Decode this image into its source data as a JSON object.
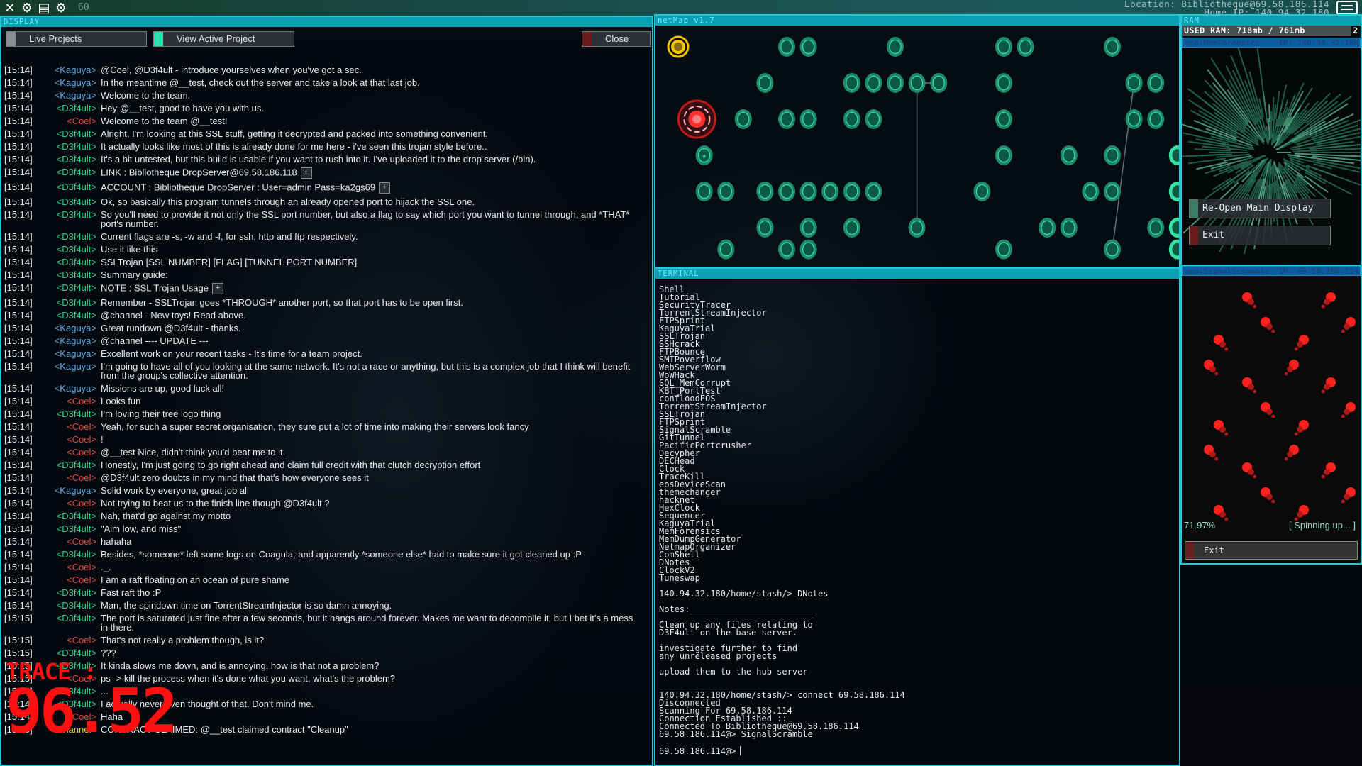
{
  "topbar": {
    "icons": [
      "close-icon",
      "gear-icon",
      "save-icon",
      "gear-icon"
    ],
    "fps": "60",
    "location": "Location: Bibliotheque@69.58.186.114",
    "home_ip": "Home IP: 140.94.32.180"
  },
  "display": {
    "title": "DISPLAY",
    "live_projects": "Live Projects",
    "view_active_project": "View Active Project",
    "close": "Close",
    "messages": [
      {
        "ts": "[15:14]",
        "nick": "<Kaguya>",
        "cls": "kaguya",
        "text": "@Coel, @D3f4ult - introduce yourselves when you've got a sec."
      },
      {
        "ts": "[15:14]",
        "nick": "<Kaguya>",
        "cls": "kaguya",
        "text": "In the meantime @__test, check out the server and take a look at that last job."
      },
      {
        "ts": "[15:14]",
        "nick": "<Kaguya>",
        "cls": "kaguya",
        "text": "Welcome to the team."
      },
      {
        "ts": "[15:14]",
        "nick": "<D3f4ult>",
        "cls": "d3f4ult",
        "text": "Hey @__test, good to have you with us."
      },
      {
        "ts": "[15:14]",
        "nick": "<Coel>",
        "cls": "coel",
        "text": "Welcome to the team @__test!"
      },
      {
        "ts": "[15:14]",
        "nick": "<D3f4ult>",
        "cls": "d3f4ult",
        "text": "Alright, I'm looking at this SSL stuff, getting it decrypted and packed into something convenient."
      },
      {
        "ts": "[15:14]",
        "nick": "<D3f4ult>",
        "cls": "d3f4ult",
        "text": "It actually looks like most of this is already done for me here - i've seen this trojan style before.."
      },
      {
        "ts": "[15:14]",
        "nick": "<D3f4ult>",
        "cls": "d3f4ult",
        "text": "It's a bit untested, but this build is usable if you want to rush into it. I've uploaded it to the drop server (/bin)."
      },
      {
        "ts": "[15:14]",
        "nick": "<D3f4ult>",
        "cls": "d3f4ult",
        "text": "LINK : Bibliotheque DropServer@69.58.186.118",
        "plus": true
      },
      {
        "ts": "[15:14]",
        "nick": "<D3f4ult>",
        "cls": "d3f4ult",
        "text": "ACCOUNT : Bibliotheque DropServer : User=admin Pass=ka2gs69",
        "plus": true
      },
      {
        "ts": "[15:14]",
        "nick": "<D3f4ult>",
        "cls": "d3f4ult",
        "text": "Ok, so basically this program tunnels through an already opened port to hijack the SSL one."
      },
      {
        "ts": "[15:14]",
        "nick": "<D3f4ult>",
        "cls": "d3f4ult",
        "text": "So you'll need to provide it not only the SSL port number, but also a flag to say which port you want to tunnel through, and *THAT* port's number."
      },
      {
        "ts": "[15:14]",
        "nick": "<D3f4ult>",
        "cls": "d3f4ult",
        "text": "Current flags are -s, -w and -f, for ssh, http and ftp respectively."
      },
      {
        "ts": "[15:14]",
        "nick": "<D3f4ult>",
        "cls": "d3f4ult",
        "text": "Use it like this"
      },
      {
        "ts": "[15:14]",
        "nick": "<D3f4ult>",
        "cls": "d3f4ult",
        "text": "SSLTrojan [SSL NUMBER] [FLAG] [TUNNEL PORT NUMBER]"
      },
      {
        "ts": "[15:14]",
        "nick": "<D3f4ult>",
        "cls": "d3f4ult",
        "text": "Summary guide:"
      },
      {
        "ts": "[15:14]",
        "nick": "<D3f4ult>",
        "cls": "d3f4ult",
        "text": "NOTE : SSL Trojan Usage",
        "plus": true
      },
      {
        "ts": "[15:14]",
        "nick": "<D3f4ult>",
        "cls": "d3f4ult",
        "text": "Remember - SSLTrojan goes *THROUGH* another port, so that port has to be open first."
      },
      {
        "ts": "[15:14]",
        "nick": "<D3f4ult>",
        "cls": "d3f4ult",
        "text": "@channel - New toys! Read above."
      },
      {
        "ts": "[15:14]",
        "nick": "<Kaguya>",
        "cls": "kaguya",
        "text": "Great rundown @D3f4ult - thanks."
      },
      {
        "ts": "[15:14]",
        "nick": "<Kaguya>",
        "cls": "kaguya",
        "text": "@channel ---- UPDATE ---"
      },
      {
        "ts": "[15:14]",
        "nick": "<Kaguya>",
        "cls": "kaguya",
        "text": "Excellent work on your recent tasks - It's time for a team project."
      },
      {
        "ts": "[15:14]",
        "nick": "<Kaguya>",
        "cls": "kaguya",
        "text": "I'm going to have all of you looking at the same network. It's not a race or anything, but this is a complex job that I think will benefit from the group's collective attention."
      },
      {
        "ts": "[15:14]",
        "nick": "<Kaguya>",
        "cls": "kaguya",
        "text": "Missions are up, good luck all!"
      },
      {
        "ts": "[15:14]",
        "nick": "<Coel>",
        "cls": "coel",
        "text": "Looks fun"
      },
      {
        "ts": "[15:14]",
        "nick": "<D3f4ult>",
        "cls": "d3f4ult",
        "text": "I'm loving their tree logo thing"
      },
      {
        "ts": "[15:14]",
        "nick": "<Coel>",
        "cls": "coel",
        "text": "Yeah, for such a super secret organisation, they sure put a lot of time into making their servers look fancy"
      },
      {
        "ts": "[15:14]",
        "nick": "<Coel>",
        "cls": "coel",
        "text": "!"
      },
      {
        "ts": "[15:14]",
        "nick": "<Coel>",
        "cls": "coel",
        "text": "@__test Nice, didn't think you'd beat me to it."
      },
      {
        "ts": "[15:14]",
        "nick": "<D3f4ult>",
        "cls": "d3f4ult",
        "text": "Honestly, I'm just going to go right ahead and claim full credit with that clutch decryption effort"
      },
      {
        "ts": "[15:14]",
        "nick": "<Coel>",
        "cls": "coel",
        "text": "@D3f4ult zero doubts in my mind that that's how everyone sees it"
      },
      {
        "ts": "[15:14]",
        "nick": "<Kaguya>",
        "cls": "kaguya",
        "text": "Solid work by everyone, great job all"
      },
      {
        "ts": "[15:14]",
        "nick": "<Coel>",
        "cls": "coel",
        "text": "Not trying to beat us to the finish line though @D3f4ult ?"
      },
      {
        "ts": "[15:14]",
        "nick": "<D3f4ult>",
        "cls": "d3f4ult",
        "text": "Nah, that'd go against my motto"
      },
      {
        "ts": "[15:14]",
        "nick": "<D3f4ult>",
        "cls": "d3f4ult",
        "text": "\"Aim low, and miss\""
      },
      {
        "ts": "[15:14]",
        "nick": "<Coel>",
        "cls": "coel",
        "text": "hahaha"
      },
      {
        "ts": "[15:14]",
        "nick": "<D3f4ult>",
        "cls": "d3f4ult",
        "text": "Besides, *someone* left some logs on Coagula, and apparently *someone else* had to make sure it got cleaned up :P"
      },
      {
        "ts": "[15:14]",
        "nick": "<Coel>",
        "cls": "coel",
        "text": "._."
      },
      {
        "ts": "[15:14]",
        "nick": "<Coel>",
        "cls": "coel",
        "text": "I am a raft floating on an ocean of pure shame"
      },
      {
        "ts": "[15:14]",
        "nick": "<D3f4ult>",
        "cls": "d3f4ult",
        "text": "Fast raft tho :P"
      },
      {
        "ts": "[15:14]",
        "nick": "<D3f4ult>",
        "cls": "d3f4ult",
        "text": "Man, the spindown time on TorrentStreamInjector is so damn annoying."
      },
      {
        "ts": "[15:15]",
        "nick": "<D3f4ult>",
        "cls": "d3f4ult",
        "text": "The port is saturated just fine after a few seconds, but it hangs around forever. Makes me want to decompile it, but I bet it's a mess in there."
      },
      {
        "ts": "[15:15]",
        "nick": "<Coel>",
        "cls": "coel",
        "text": "That's not really a problem though, is it?"
      },
      {
        "ts": "[15:15]",
        "nick": "<D3f4ult>",
        "cls": "d3f4ult",
        "text": "???"
      },
      {
        "ts": "[15:15]",
        "nick": "<D3f4ult>",
        "cls": "d3f4ult",
        "text": "It kinda slows me down, and is annoying, how is that not a problem?"
      },
      {
        "ts": "[15:15]",
        "nick": "<Coel>",
        "cls": "coel",
        "text": "ps -> kill the process when it's done what you want, what's the problem?"
      },
      {
        "ts": "[15:15]",
        "nick": "<D3f4ult>",
        "cls": "d3f4ult",
        "text": "..."
      },
      {
        "ts": "[15:14]",
        "nick": "<D3f4ult>",
        "cls": "d3f4ult",
        "text": "I actually never even thought of that. Don't mind me."
      },
      {
        "ts": "[15:14]",
        "nick": "<Coel>",
        "cls": "coel",
        "text": "Haha"
      },
      {
        "ts": "[15:15]",
        "nick": "<Channel>",
        "cls": "channel",
        "text": "CONTRACT CLAIMED: @__test claimed contract \"Cleanup\""
      }
    ]
  },
  "trace": {
    "label": "TRACE :",
    "value": "96.52"
  },
  "netmap": {
    "title": "netMap v1.7",
    "colors": {
      "node": "#1f8a6a",
      "node_ring": "#3ae0a6",
      "home": "#f5c400",
      "connected": "#ff3030",
      "highlight": "#35e2a0"
    },
    "nodes": [
      {
        "c": 0,
        "r": 0,
        "type": "home"
      },
      {
        "c": 5,
        "r": 0
      },
      {
        "c": 6,
        "r": 0
      },
      {
        "c": 10,
        "r": 0
      },
      {
        "c": 15,
        "r": 0
      },
      {
        "c": 16,
        "r": 0
      },
      {
        "c": 20,
        "r": 0
      },
      {
        "c": 4,
        "r": 1
      },
      {
        "c": 8,
        "r": 1
      },
      {
        "c": 9,
        "r": 1
      },
      {
        "c": 10,
        "r": 1
      },
      {
        "c": 11,
        "r": 1
      },
      {
        "c": 12,
        "r": 1
      },
      {
        "c": 15,
        "r": 1
      },
      {
        "c": 21,
        "r": 1
      },
      {
        "c": 22,
        "r": 1
      },
      {
        "c": 0.6,
        "r": 2,
        "type": "connected"
      },
      {
        "c": 3,
        "r": 2
      },
      {
        "c": 5,
        "r": 2
      },
      {
        "c": 6,
        "r": 2
      },
      {
        "c": 8,
        "r": 2
      },
      {
        "c": 9,
        "r": 2
      },
      {
        "c": 15,
        "r": 2
      },
      {
        "c": 21,
        "r": 2
      },
      {
        "c": 22,
        "r": 2
      },
      {
        "c": 1.2,
        "r": 3,
        "type": "star"
      },
      {
        "c": 15,
        "r": 3
      },
      {
        "c": 18,
        "r": 3
      },
      {
        "c": 20,
        "r": 3
      },
      {
        "c": 23,
        "r": 3,
        "type": "highlight"
      },
      {
        "c": 1.2,
        "r": 4
      },
      {
        "c": 2.2,
        "r": 4
      },
      {
        "c": 4,
        "r": 4
      },
      {
        "c": 5,
        "r": 4
      },
      {
        "c": 6,
        "r": 4
      },
      {
        "c": 7,
        "r": 4
      },
      {
        "c": 8,
        "r": 4
      },
      {
        "c": 9,
        "r": 4
      },
      {
        "c": 14,
        "r": 4
      },
      {
        "c": 19,
        "r": 4
      },
      {
        "c": 20,
        "r": 4
      },
      {
        "c": 23,
        "r": 4,
        "type": "highlight"
      },
      {
        "c": 4,
        "r": 5
      },
      {
        "c": 6,
        "r": 5
      },
      {
        "c": 8,
        "r": 5
      },
      {
        "c": 11,
        "r": 5
      },
      {
        "c": 17,
        "r": 5
      },
      {
        "c": 18,
        "r": 5
      },
      {
        "c": 22,
        "r": 5
      },
      {
        "c": 23,
        "r": 5,
        "type": "highlight"
      },
      {
        "c": 2.2,
        "r": 5.6
      },
      {
        "c": 5,
        "r": 5.6
      },
      {
        "c": 6,
        "r": 5.6
      },
      {
        "c": 15,
        "r": 5.6
      },
      {
        "c": 20,
        "r": 5.6
      },
      {
        "c": 23,
        "r": 5.6,
        "type": "highlight"
      }
    ],
    "links": [
      [
        11,
        1,
        12,
        1
      ],
      [
        11,
        1,
        11,
        5
      ],
      [
        21,
        1,
        20,
        5.6
      ]
    ]
  },
  "terminal": {
    "title": "TERMINAL",
    "programs": [
      "Shell",
      "Tutorial",
      "SecurityTracer",
      "TorrentStreamInjector",
      "FTPSprint",
      "KaguyaTrial",
      "SSLTrojan",
      "SSHcrack",
      "FTPBounce",
      "SMTPoverflow",
      "WebServerWorm",
      "WoWHack",
      "SQL_MemCorrupt",
      "KBT_PortTest",
      "confloodEOS",
      "TorrentStreamInjector",
      "SSLTrojan",
      "FTPSprint",
      "SignalScramble",
      "GitTunnel",
      "PacificPortcrusher",
      "Decypher",
      "DECHead",
      "Clock",
      "TraceKill",
      "eosDeviceScan",
      "themechanger",
      "hacknet",
      "HexClock",
      "Sequencer",
      "KaguyaTrial",
      "MemForensics",
      "MemDumpGenerator",
      "NetmapOrganizer",
      "ComShell",
      "DNotes",
      "ClockV2",
      "Tuneswap"
    ],
    "blocks": [
      [
        "140.94.32.180/home/stash/> DNotes"
      ],
      [
        "Notes:________________________"
      ],
      [
        "Clean up any files relating to",
        "D3F4ult on the base server."
      ],
      [
        "investigate further to find",
        "any unreleased projects"
      ],
      [
        "upload them to the hub server"
      ],
      [
        "______________________________",
        "140.94.32.180/home/stash/> connect 69.58.186.114",
        "Disconnected",
        "Scanning For 69.58.186.114",
        "Connection Established ::",
        "Connected To Bibliotheque@69.58.186.114",
        "69.58.186.114@> SignalScramble"
      ]
    ],
    "prompt": "69.58.186.114@>"
  },
  "ram": {
    "title": "RAM",
    "used": "USED RAM: 718mb / 761mb",
    "count": "2",
    "app1": {
      "name": "app:MemForensics",
      "ip": "IP: 140.94.32.180",
      "reopen": "Re-Open Main Display",
      "exit": "Exit"
    },
    "app2": {
      "name": "app:SignalScramble",
      "ip": "IP: 69.58.186.114",
      "percent": "71.97%",
      "status": "[ Spinning up... ]",
      "exit": "Exit"
    }
  }
}
